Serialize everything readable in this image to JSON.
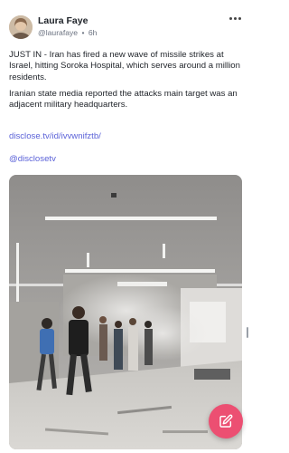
{
  "post": {
    "author_name": "Laura Faye",
    "author_handle": "@laurafaye",
    "separator": "•",
    "time": "6h",
    "paragraph_1": "JUST IN - Iran has fired a new wave of missile strikes at Israel, hitting Soroka Hospital, which serves around a million residents.",
    "paragraph_2": "Iranian state media reported the attacks main target was an adjacent military headquarters.",
    "link_url": "disclose.tv/id/ivvwnifztb/",
    "link_mention": "@disclosetv"
  },
  "icons": {
    "more": "more-horizontal-icon",
    "compose": "edit-icon"
  },
  "colors": {
    "link": "#5b62d8",
    "fab": "#ec4f72",
    "text": "#1f2329",
    "meta": "#6b7280"
  }
}
